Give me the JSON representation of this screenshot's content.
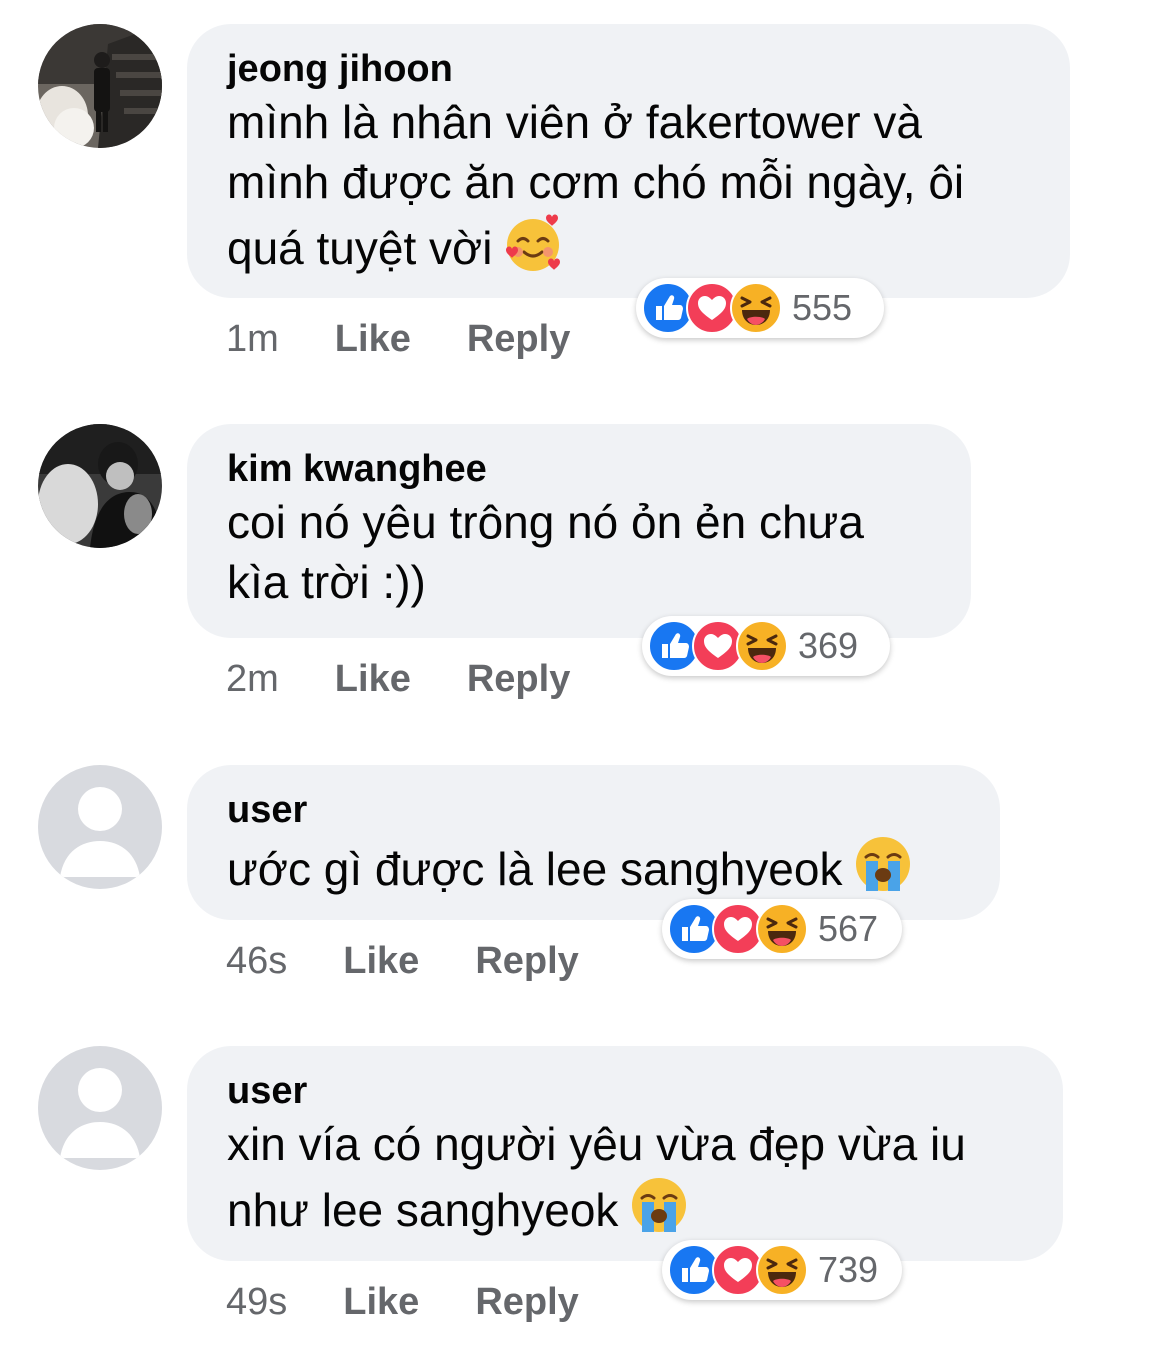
{
  "comments": [
    {
      "author": "jeong jihoon",
      "text": "mình là nhân viên ở fakertower và\nmình được ăn cơm chó mỗi ngày, ôi\nquá tuyệt vời",
      "emoji": "smiling-face-with-hearts",
      "time": "1m",
      "like": "Like",
      "reply": "Reply",
      "reaction_count": "555",
      "avatar": "photo"
    },
    {
      "author": "kim kwanghee",
      "text": "coi nó yêu trông nó ỏn ẻn chưa\nkìa trời :))",
      "emoji": "",
      "time": "2m",
      "like": "Like",
      "reply": "Reply",
      "reaction_count": "369",
      "avatar": "photo-bw"
    },
    {
      "author": "user",
      "text": "ước gì được là lee sanghyeok",
      "emoji": "loudly-crying-face",
      "time": "46s",
      "like": "Like",
      "reply": "Reply",
      "reaction_count": "567",
      "avatar": "default"
    },
    {
      "author": "user",
      "text": "xin vía có người yêu vừa đẹp vừa iu\nnhư lee sanghyeok",
      "emoji": "loudly-crying-face",
      "time": "49s",
      "like": "Like",
      "reply": "Reply",
      "reaction_count": "739",
      "avatar": "default"
    }
  ],
  "colors": {
    "bubble": "#f0f2f5",
    "meta_text": "#65676b",
    "like_blue": "#1877f2",
    "love_red": "#f33e58",
    "haha_yellow": "#f7b125"
  }
}
